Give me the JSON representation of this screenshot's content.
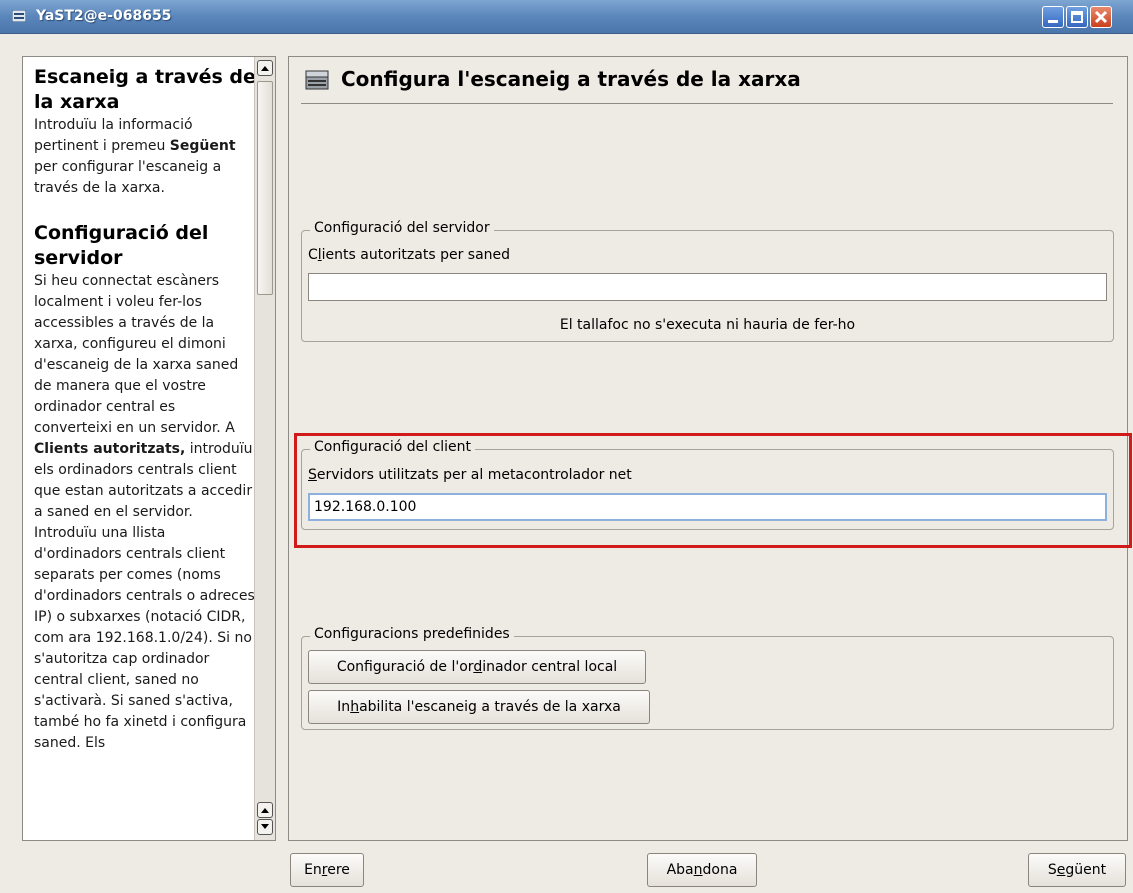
{
  "window": {
    "title": "YaST2@e-068655"
  },
  "help": {
    "h1": "Escaneig a través de la xarxa",
    "p1_a": "Introduïu la informació pertinent i premeu ",
    "p1_b": "Següent",
    "p1_c": " per configurar l'escaneig a través de la xarxa.",
    "h2": "Configuració del servidor",
    "p2_a": "Si heu connectat escàners localment i voleu fer-los accessibles a través de la xarxa, configureu el dimoni d'escaneig de la xarxa saned de manera que el vostre ordinador central es converteixi en un servidor. A ",
    "p2_b": "Clients autoritzats,",
    "p2_c": " introduïu els ordinadors centrals client que estan autoritzats a accedir a saned en el servidor. Introduïu una llista d'ordinadors centrals client separats per comes (noms d'ordinadors centrals o adreces IP) o subxarxes (notació CIDR, com ara 192.168.1.0/24). Si no s'autoritza cap ordinador central client, saned no s'activarà. Si saned s'activa, també ho fa xinetd i configura saned. Els"
  },
  "main": {
    "title": "Configura l'escaneig a través de la xarxa",
    "server": {
      "legend": "Configuració del servidor",
      "label_pre": "C",
      "label_u": "l",
      "label_post": "ients autoritzats per saned",
      "value": "",
      "firewall_note": "El tallafoc no s'executa ni hauria de fer-ho"
    },
    "client": {
      "legend": "Configuració del client",
      "label_u": "S",
      "label_post": "ervidors utilitzats per al metacontrolador net",
      "value": "192.168.0.100"
    },
    "presets": {
      "legend": "Configuracions predefinides",
      "local_pre": "Configuració de l'or",
      "local_u": "d",
      "local_post": "inador central local",
      "disable_pre": "In",
      "disable_u": "h",
      "disable_post": "abilita l'escaneig a través de la xarxa"
    }
  },
  "footer": {
    "back_pre": "En",
    "back_u": "r",
    "back_post": "ere",
    "abort_pre": "Aba",
    "abort_u": "n",
    "abort_post": "dona",
    "next_pre": "S",
    "next_u": "e",
    "next_post": "güent"
  },
  "colors": {
    "highlight": "#d11a1a",
    "titlebar": "#5a86bb",
    "background": "#eeeae4"
  },
  "icons": [
    "window-menu-icon",
    "minimize-icon",
    "maximize-icon",
    "close-icon",
    "scanner-icon",
    "scroll-up-icon",
    "scroll-down-icon"
  ]
}
